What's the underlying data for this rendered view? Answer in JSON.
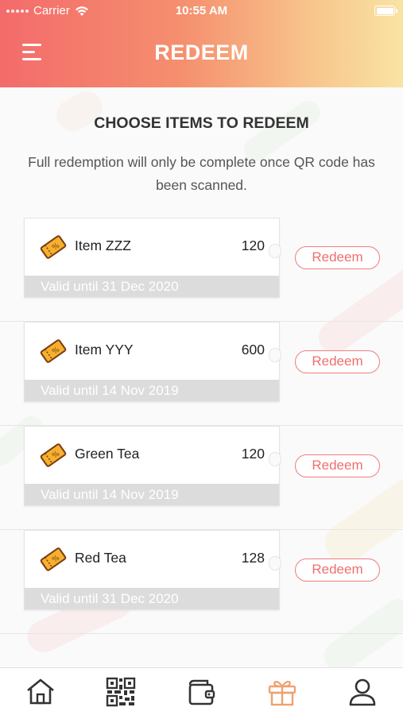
{
  "status_bar": {
    "carrier": "Carrier",
    "time": "10:55 AM"
  },
  "header": {
    "title": "REDEEM",
    "menu_icon": "hamburger-menu-icon"
  },
  "main": {
    "heading": "CHOOSE ITEMS TO REDEEM",
    "note": "Full redemption will only be complete once QR code has been scanned."
  },
  "items": [
    {
      "name": "Item ZZZ",
      "points": "120",
      "validity": "Valid until 31 Dec 2020",
      "button": "Redeem"
    },
    {
      "name": "Item YYY",
      "points": "600",
      "validity": "Valid until 14 Nov 2019",
      "button": "Redeem"
    },
    {
      "name": "Green Tea",
      "points": "120",
      "validity": "Valid until 14 Nov 2019",
      "button": "Redeem"
    },
    {
      "name": "Red Tea",
      "points": "128",
      "validity": "Valid until 31 Dec 2020",
      "button": "Redeem"
    }
  ],
  "tab_bar": {
    "tabs": [
      {
        "icon": "home-icon"
      },
      {
        "icon": "qr-code-icon"
      },
      {
        "icon": "wallet-icon"
      },
      {
        "icon": "gift-icon",
        "active": true
      },
      {
        "icon": "profile-icon"
      }
    ],
    "active_color": "#f0a070",
    "inactive_color": "#333333"
  },
  "colors": {
    "accent": "#ef6f6f",
    "header_gradient_start": "#f36b6b",
    "header_gradient_end": "#f9e3a4"
  }
}
